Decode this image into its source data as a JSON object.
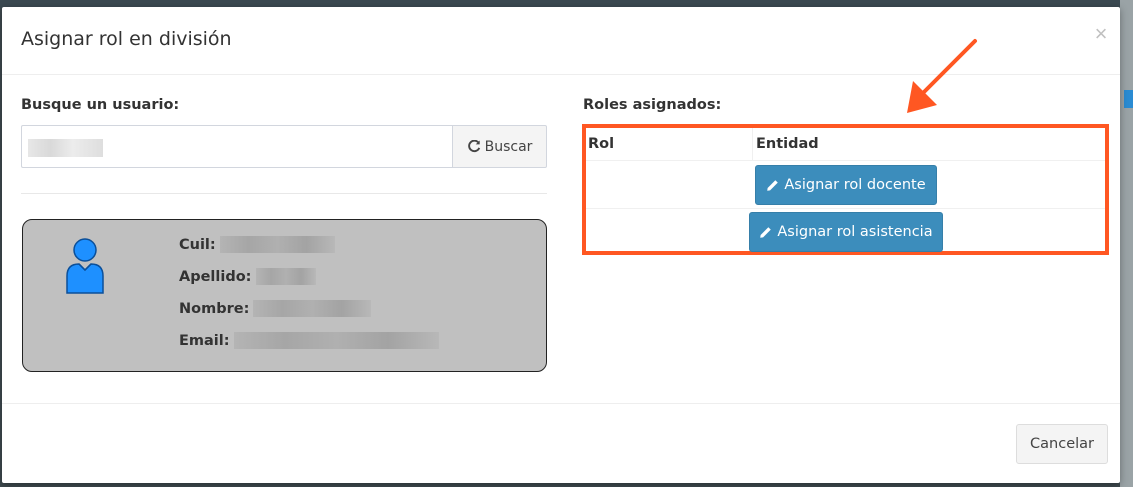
{
  "modal": {
    "title": "Asignar rol en división",
    "close_glyph": "×"
  },
  "search": {
    "label": "Busque un usuario:",
    "value": "",
    "button_label": "Buscar",
    "button_icon": "refresh-icon"
  },
  "user_card": {
    "icon": "user-icon",
    "fields": [
      {
        "label": "Cuil:"
      },
      {
        "label": "Apellido:"
      },
      {
        "label": "Nombre:"
      },
      {
        "label": "Email:"
      }
    ]
  },
  "roles": {
    "label": "Roles asignados:",
    "columns": [
      "Rol",
      "Entidad"
    ],
    "actions": [
      {
        "label": "Asignar rol docente",
        "icon": "pencil-icon"
      },
      {
        "label": "Asignar rol asistencia",
        "icon": "pencil-icon"
      }
    ]
  },
  "footer": {
    "cancel_label": "Cancelar"
  },
  "colors": {
    "primary": "#3c8dbc",
    "highlight": "#ff5722",
    "card_bg": "#c0c0c0",
    "user_icon": "#1e90ff"
  }
}
